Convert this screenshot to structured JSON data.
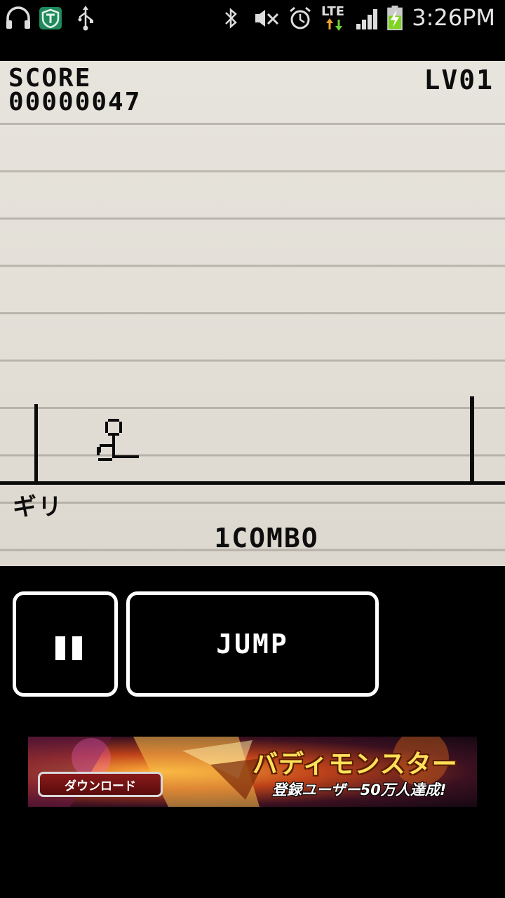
{
  "status_bar": {
    "time": "3:26PM",
    "network": "LTE",
    "icons": [
      "headphones-icon",
      "vpn-shield-icon",
      "usb-icon",
      "bluetooth-icon",
      "mute-icon",
      "alarm-icon",
      "lte-data-icon",
      "signal-icon",
      "battery-charging-icon"
    ]
  },
  "game": {
    "score_label": "SCORE",
    "score_value": "00000047",
    "level": "LV01",
    "kana": "ギリ",
    "combo": "1COMBO"
  },
  "controls": {
    "jump_label": "JUMP"
  },
  "ad": {
    "button_label": "ダウンロード",
    "title": "バディモンスター",
    "subtitle": "登録ユーザー50万人達成!"
  }
}
